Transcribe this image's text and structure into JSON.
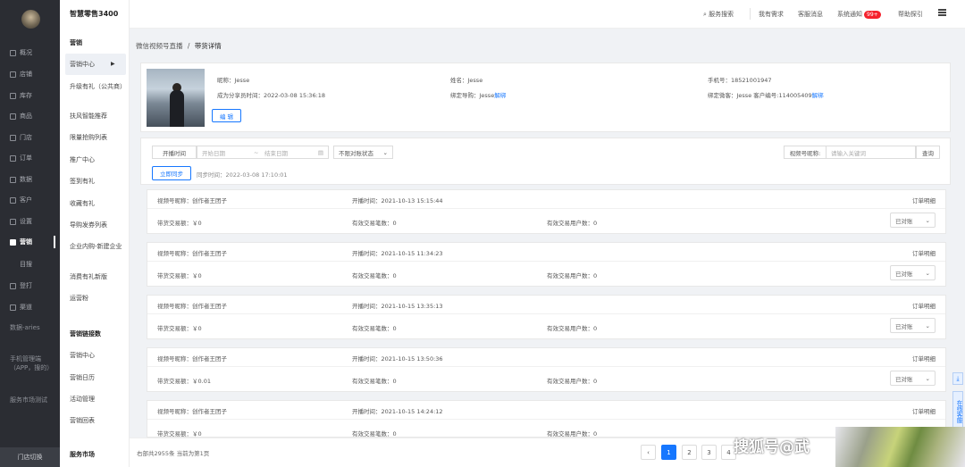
{
  "leftnav": {
    "items": [
      "概况",
      "店铺",
      "库存",
      "商品",
      "门店",
      "订单",
      "数据",
      "客户",
      "设置",
      "营销",
      "目搜",
      "登打",
      "渠道"
    ],
    "subs": [
      "数据-aries",
      "手机管理端（APP，搜的）",
      "服务市场测试"
    ],
    "footer": "门店切换"
  },
  "subnav": {
    "brand": "智慧零售3400",
    "items": [
      "营销",
      "营销中心",
      "升级有礼（公共商）",
      "扶风智能推荐",
      "限量抢购列表",
      "推广中心",
      "签到有礼",
      "收藏有礼",
      "导购发券列表",
      "企业内购-新建企业",
      "消费有礼新版",
      "运营粉",
      "营销链接数",
      "营销中心",
      "营销日历",
      "活动管理",
      "营销回表",
      "服务市场"
    ]
  },
  "topbar": {
    "search": "服务搜索",
    "items": [
      "我有需求",
      "客服消息",
      "系统通知"
    ],
    "badge": "99+",
    "help": "帮助探引"
  },
  "breadcrumb": {
    "parent": "微信视频号直播",
    "sep": "/",
    "current": "带货详情"
  },
  "profile": {
    "nick": "昵称：Jesse",
    "name": "姓名：Jesse",
    "phone": "手机号：18521001947",
    "since": "成为分享员时间：2022-03-08 15:36:18",
    "guide": "绑定导购：Jesse",
    "guide_link": "解绑",
    "wx": "绑定微客：Jesse 客户编号:114005409",
    "wx_link": "解绑",
    "edit": "编 辑"
  },
  "filter": {
    "time_label": "开播时间",
    "start_ph": "开始日期",
    "tilde": "~",
    "end_ph": "结束日期",
    "status": "不限对账状态",
    "channel_label": "视频号昵称:",
    "search_ph": "请输入关键词",
    "search_btn": "查询",
    "sync_btn": "立即同步",
    "sync_time": "同步时间：2022-03-08 17:10:01"
  },
  "cards": [
    {
      "channel": "视频号昵称：创作者王团子",
      "time": "开播时间：2021-10-13 15:15:44",
      "order": "订单明细",
      "gmv": "带货交易额：￥0",
      "count": "有效交易笔数：0",
      "users": "有效交易用户数：0",
      "status": "已对账"
    },
    {
      "channel": "视频号昵称：创作者王团子",
      "time": "开播时间：2021-10-15 11:34:23",
      "order": "订单明细",
      "gmv": "带货交易额：￥0",
      "count": "有效交易笔数：0",
      "users": "有效交易用户数：0",
      "status": "已对账"
    },
    {
      "channel": "视频号昵称：创作者王团子",
      "time": "开播时间：2021-10-15 13:35:13",
      "order": "订单明细",
      "gmv": "带货交易额：￥0",
      "count": "有效交易笔数：0",
      "users": "有效交易用户数：0",
      "status": "已对账"
    },
    {
      "channel": "视频号昵称：创作者王团子",
      "time": "开播时间：2021-10-15 13:50:36",
      "order": "订单明细",
      "gmv": "带货交易额：￥0.01",
      "count": "有效交易笔数：0",
      "users": "有效交易用户数：0",
      "status": "已对账"
    },
    {
      "channel": "视频号昵称：创作者王团子",
      "time": "开播时间：2021-10-15 14:24:12",
      "order": "订单明细",
      "gmv": "带货交易额：￥0",
      "count": "有效交易笔数：0",
      "users": "有效交易用户数：0",
      "status": ""
    }
  ],
  "pagination": {
    "total": "右部共2955条 当前为第1页",
    "prev": "‹",
    "pages": [
      "1",
      "2",
      "3",
      "4"
    ]
  },
  "side": {
    "download": "⤓",
    "service": "在线客服"
  },
  "watermark": "搜狐号@武"
}
